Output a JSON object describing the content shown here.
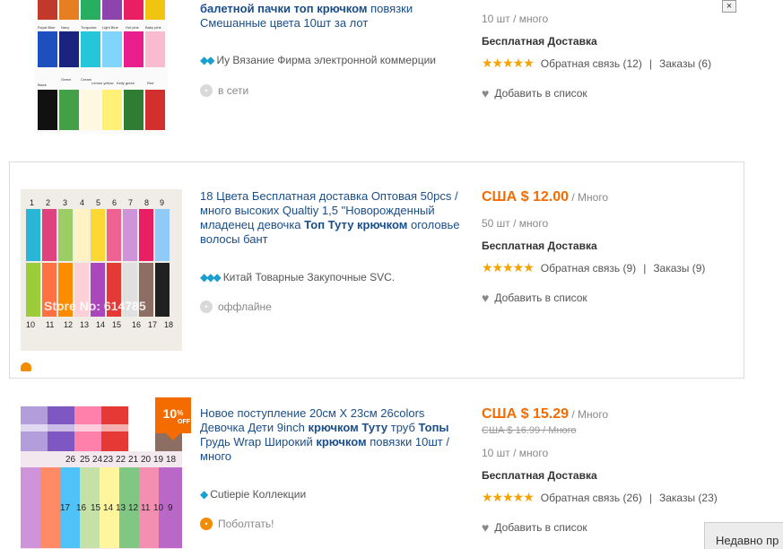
{
  "items": [
    {
      "title_parts": [
        {
          "text": "балетной пачки ",
          "bold": true
        },
        {
          "text": "топ крючком",
          "bold": true
        },
        {
          "text": " повязки Смешанные цвета 10шт за лот",
          "bold": false
        }
      ],
      "seller": "Иу Вязание Фирма электронной коммерции",
      "status": "в сети",
      "qty": "10 шт / много",
      "shipping": "Бесплатная Доставка",
      "feedback": "Обратная связь (12)",
      "orders": "Заказы (6)",
      "add_to_list": "Добавить в список",
      "swatch_labels": [
        "Royal Blue",
        "Navy",
        "Turquoise",
        "Light Blue",
        "Hot pink",
        "Baby pink",
        "Black",
        "Green",
        "Cream",
        "Lemon yellow",
        "Kelly green",
        "Red"
      ]
    },
    {
      "title_parts": [
        {
          "text": "18 Цвета Бесплатная доставка Оптовая 50pcs / много высоких Qualtiy 1,5 \"Новорожденный младенец девочка ",
          "bold": false
        },
        {
          "text": "Топ Туту крючком",
          "bold": true
        },
        {
          "text": " оголовье волосы бант",
          "bold": false
        }
      ],
      "price": "США $ 12.00",
      "unit": " / Много",
      "seller": "Китай Товарные Закупочные SVC.",
      "status": "оффлайне",
      "qty": "50 шт / много",
      "shipping": "Бесплатная Доставка",
      "feedback": "Обратная связь (9)",
      "orders": "Заказы (9)",
      "add_to_list": "Добавить в список",
      "image_watermark": "Store No: 614785",
      "numbers_top": [
        "1",
        "2",
        "3",
        "4",
        "5",
        "6",
        "7",
        "8",
        "9"
      ],
      "numbers_bottom": [
        "10",
        "11",
        "12",
        "13",
        "14",
        "15",
        "16",
        "17",
        "18"
      ]
    },
    {
      "title_parts": [
        {
          "text": "Новое поступление 20см X 23см 26colors Девочка Дети 9inch ",
          "bold": false
        },
        {
          "text": "крючком Туту",
          "bold": true
        },
        {
          "text": " труб ",
          "bold": false
        },
        {
          "text": "Топы",
          "bold": true
        },
        {
          "text": " Грудь Wrap Широкий ",
          "bold": false
        },
        {
          "text": "крючком",
          "bold": true
        },
        {
          "text": " повязки 10шт / много",
          "bold": false
        }
      ],
      "price": "США $ 15.29",
      "unit": " / Много",
      "old_price": "США $ 16.99 / Много",
      "seller": "Cutiepie Коллекции",
      "status": "Поболтать!",
      "qty": "10 шт / много",
      "shipping": "Бесплатная Доставка",
      "feedback": "Обратная связь (26)",
      "orders": "Заказы (23)",
      "add_to_list": "Добавить в список",
      "discount": "10",
      "discount_suffix": "%",
      "discount_off": "OFF",
      "numbers_row1": [
        "26",
        "25",
        "24",
        "23",
        "22",
        "21",
        "20",
        "19",
        "18"
      ],
      "numbers_row2": [
        "17",
        "16",
        "15",
        "14",
        "13",
        "12",
        "11",
        "10",
        "9"
      ]
    }
  ],
  "close_label": "×",
  "recently_viewed": "Недавно пр",
  "separator": "|",
  "stars_text": "★★★★★",
  "diamond_icons": "💎💎💎"
}
